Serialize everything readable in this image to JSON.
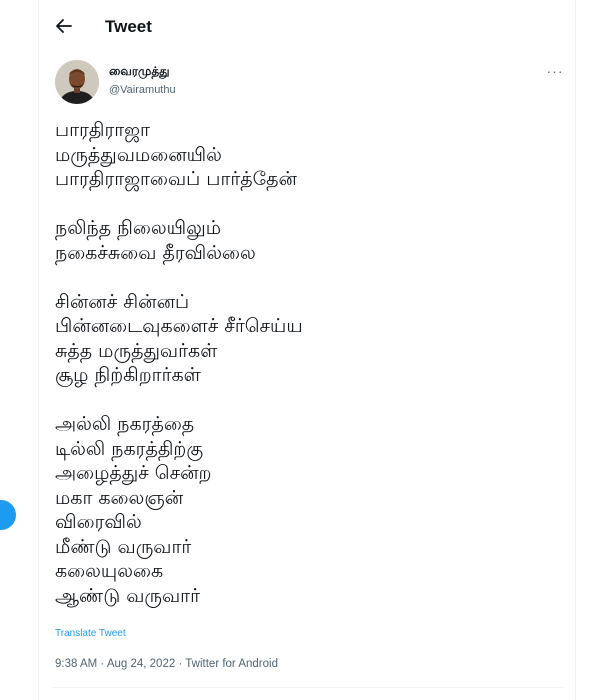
{
  "header": {
    "title": "Tweet",
    "back_icon": "arrow-left-icon"
  },
  "author": {
    "name": "வைரமுத்து",
    "handle": "@Vairamuthu"
  },
  "tweet": {
    "paragraphs": [
      [
        "பாரதிராஜா",
        "மருத்துவமனையில்",
        "பாரதிராஜாவைப் பார்த்தேன்"
      ],
      [
        "நலிந்த நிலையிலும்",
        "நகைச்சுவை தீரவில்லை"
      ],
      [
        "சின்னச் சின்னப்",
        "பின்னடைவுகளைச் சீர்செய்ய",
        "சுத்த மருத்துவர்கள்",
        "சூழ நிற்கிறார்கள்"
      ],
      [
        "அல்லி நகரத்தை",
        "டில்லி நகரத்திற்கு",
        "அழைத்துச் சென்ற",
        "மகா கலைஞன்",
        "விரைவில்",
        "மீண்டு வருவார்",
        "கலையுலகை",
        "ஆண்டு வருவார்"
      ]
    ],
    "translate_label": "Translate Tweet",
    "time": "9:38 AM",
    "separator": "·",
    "date": "Aug 24, 2022",
    "source": "Twitter for Android"
  },
  "colors": {
    "accent": "#1d9bf0",
    "text": "#0f1419",
    "muted": "#536471",
    "border": "#eff3f4"
  }
}
